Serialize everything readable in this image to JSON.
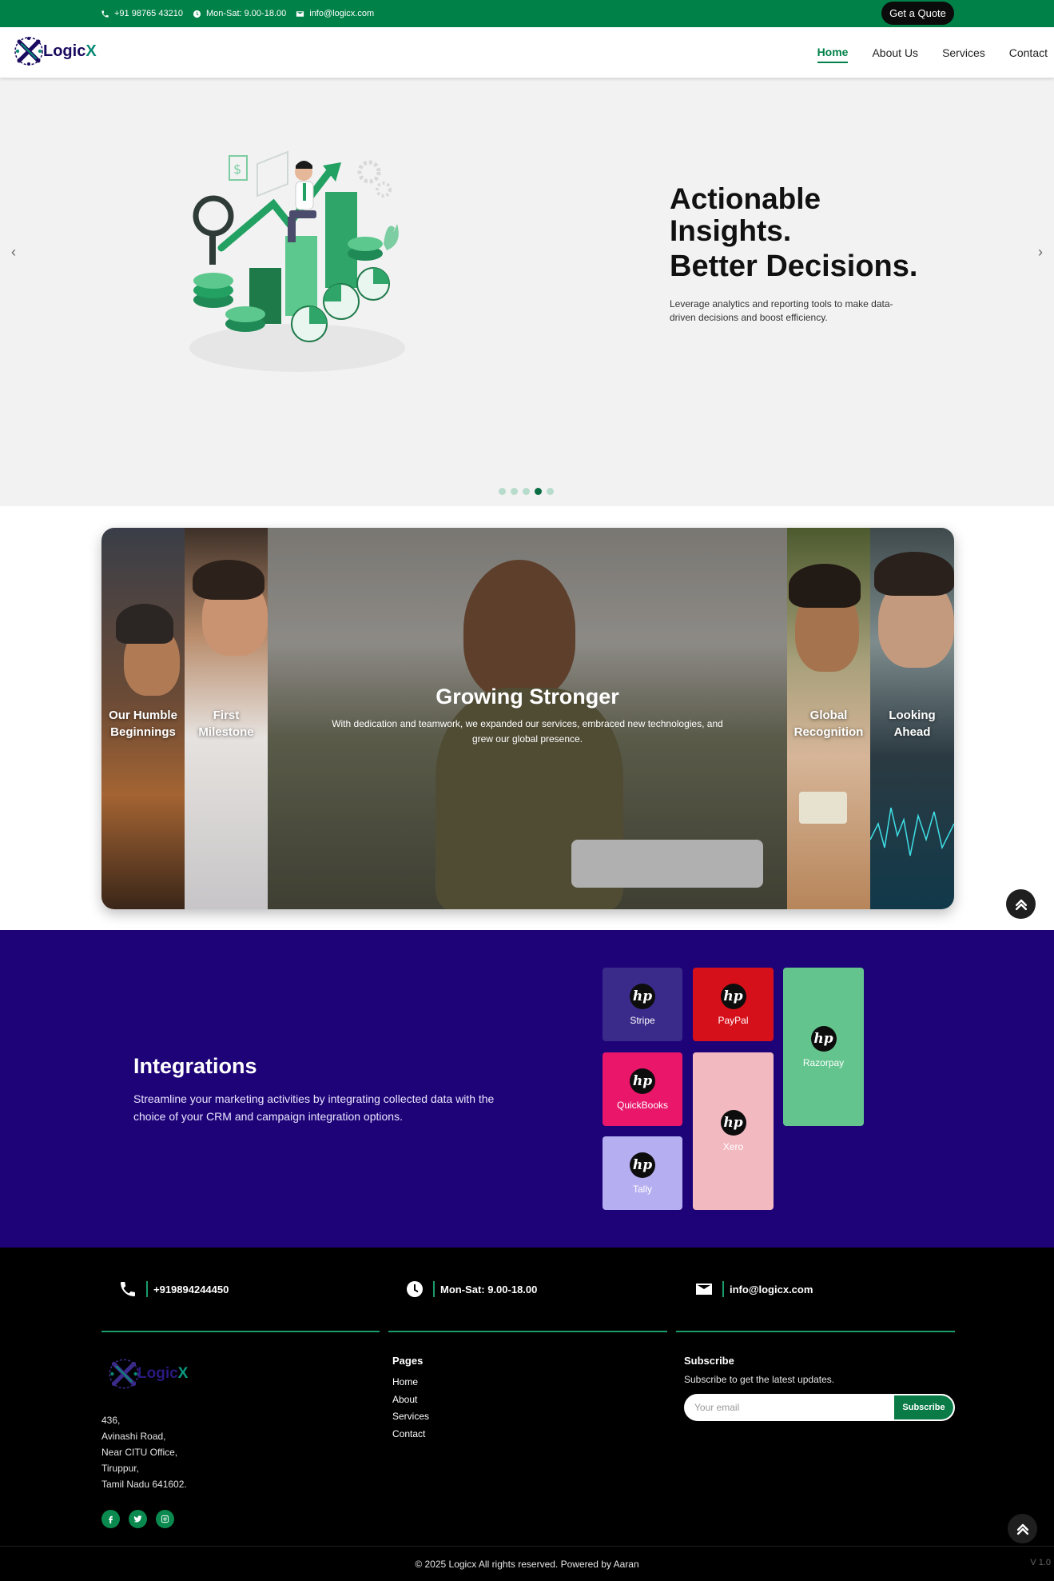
{
  "topbar": {
    "phone": "+91 98765 43210",
    "hours": "Mon-Sat: 9.00-18.00",
    "email": "info@logicx.com",
    "quote_button": "Get a Quote"
  },
  "brand": {
    "part1": "Logic",
    "part2": "X"
  },
  "nav": {
    "items": [
      {
        "label": "Home"
      },
      {
        "label": "About Us"
      },
      {
        "label": "Services"
      },
      {
        "label": "Contact"
      }
    ]
  },
  "hero": {
    "title_line1": "Actionable",
    "title_line2": "Insights.",
    "title_line3": "Better Decisions.",
    "description": "Leverage analytics and reporting tools to make data-driven decisions and boost efficiency.",
    "prev_icon": "chevron-left-icon",
    "next_icon": "chevron-right-icon",
    "slide_count": 5,
    "active_slide": 4
  },
  "timeline": {
    "panels": [
      {
        "label": "Our Humble Beginnings"
      },
      {
        "label": "First Milestone"
      },
      {
        "title": "Growing Stronger",
        "description": "With dedication and teamwork, we expanded our services, embraced new technologies, and grew our global presence."
      },
      {
        "label": "Global Recognition"
      },
      {
        "label": "Looking Ahead"
      }
    ]
  },
  "integrations": {
    "title": "Integrations",
    "description": "Streamline your marketing activities by integrating collected data with the choice of your CRM and campaign integration options.",
    "tiles": [
      {
        "name": "Stripe",
        "color": "#3a2b8a",
        "logo": "hp"
      },
      {
        "name": "PayPal",
        "color": "#d6101a",
        "logo": "hp"
      },
      {
        "name": "Razorpay",
        "color": "#63c48e",
        "logo": "hp"
      },
      {
        "name": "QuickBooks",
        "color": "#e9166a",
        "logo": "hp"
      },
      {
        "name": "Xero",
        "color": "#f2b9c0",
        "logo": "hp"
      },
      {
        "name": "Tally",
        "color": "#b5aef0",
        "logo": "hp"
      }
    ]
  },
  "footer": {
    "phone": "+919894244450",
    "hours": "Mon-Sat: 9.00-18.00",
    "email": "info@logicx.com",
    "address": [
      "436,",
      "Avinashi Road,",
      "Near CITU Office,",
      "Tiruppur,",
      "Tamil Nadu 641602."
    ],
    "social_icons": [
      "facebook-icon",
      "twitter-icon",
      "instagram-icon"
    ],
    "pages_title": "Pages",
    "pages": [
      "Home",
      "About",
      "Services",
      "Contact"
    ],
    "subscribe_title": "Subscribe",
    "subscribe_text": "Subscribe to get the latest updates.",
    "email_placeholder": "Your email",
    "subscribe_button": "Subscribe",
    "copyright": "© 2025 Logicx All rights reserved. Powered by Aaran",
    "version": "V 1.0"
  },
  "colors": {
    "brand_green": "#008148",
    "integrations_bg": "#1e0378",
    "footer_bg": "#000000"
  }
}
